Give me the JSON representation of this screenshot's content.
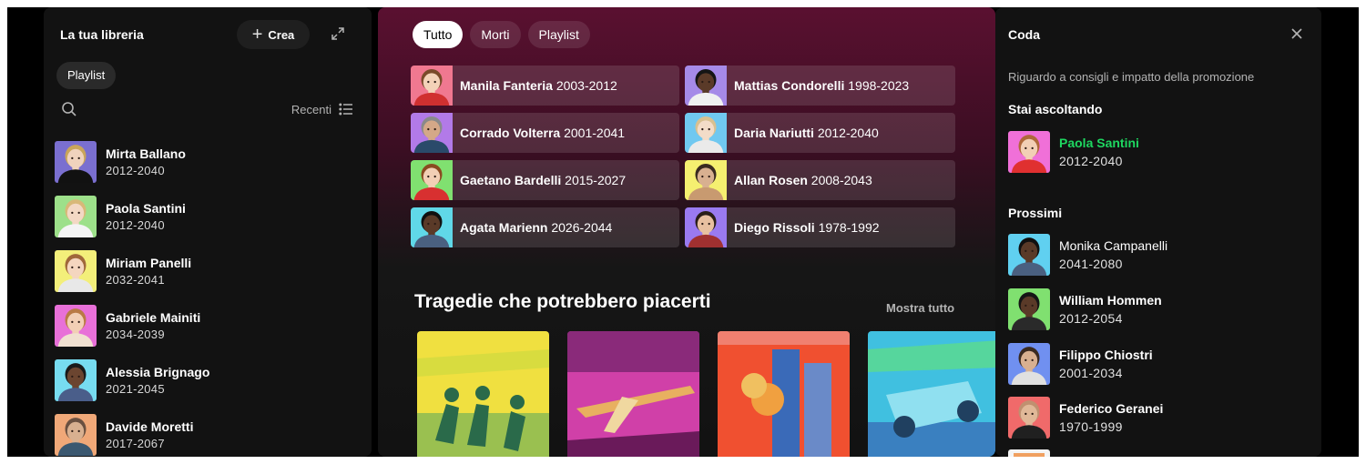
{
  "library": {
    "title": "La tua libreria",
    "create_label": "Crea",
    "filter_chip": "Playlist",
    "sort_label": "Recenti",
    "items": [
      {
        "name": "Mirta Ballano",
        "years": "2012-2040",
        "bg": "#7a6fd0",
        "skin": "#f0d2bd",
        "hair": "#c9a55a",
        "shirt": "#111111"
      },
      {
        "name": "Paola Santini",
        "years": "2012-2040",
        "bg": "#9de08a",
        "skin": "#f3d8c4",
        "hair": "#d8b878",
        "shirt": "#f4f4f4"
      },
      {
        "name": "Miriam Panelli",
        "years": "2032-2041",
        "bg": "#f3ef7a",
        "skin": "#f4d6bf",
        "hair": "#a0683a",
        "shirt": "#e8e8e8"
      },
      {
        "name": "Gabriele Mainiti",
        "years": "2034-2039",
        "bg": "#e870d8",
        "skin": "#f2cfb5",
        "hair": "#b97a45",
        "shirt": "#f0e0d0"
      },
      {
        "name": "Alessia Brignago",
        "years": "2021-2045",
        "bg": "#77dcf0",
        "skin": "#6b4530",
        "hair": "#1a1a1a",
        "shirt": "#4a5e8a"
      },
      {
        "name": "Davide Moretti",
        "years": "2017-2067",
        "bg": "#f0a878",
        "skin": "#d8b090",
        "hair": "#6a5040",
        "shirt": "#3b5870"
      }
    ]
  },
  "main": {
    "filters": [
      {
        "label": "Tutto",
        "active": true
      },
      {
        "label": "Morti",
        "active": false
      },
      {
        "label": "Playlist",
        "active": false
      }
    ],
    "tiles": [
      {
        "name": "Manila Fanteria",
        "years": "2003-2012",
        "bg": "#f07890",
        "skin": "#f3d2b8",
        "hair": "#7a4a2a",
        "shirt": "#d03030"
      },
      {
        "name": "Mattias Condorelli",
        "years": "1998-2023",
        "bg": "#a68ae8",
        "skin": "#5a3a28",
        "hair": "#151515",
        "shirt": "#f0f0f0"
      },
      {
        "name": "Corrado Volterra",
        "years": "2001-2041",
        "bg": "#b27ae8",
        "skin": "#d4a888",
        "hair": "#8a8a8a",
        "shirt": "#2a4a6a"
      },
      {
        "name": "Daria Nariutti",
        "years": "2012-2040",
        "bg": "#70c8f0",
        "skin": "#f3dcc8",
        "hair": "#d8c090",
        "shirt": "#eaeaea"
      },
      {
        "name": "Gaetano Bardelli",
        "years": "2015-2027",
        "bg": "#80e070",
        "skin": "#f2cfb5",
        "hair": "#8a4a20",
        "shirt": "#d83030"
      },
      {
        "name": "Allan Rosen",
        "years": "2008-2043",
        "bg": "#f5ef70",
        "skin": "#d8b090",
        "hair": "#3a2a20",
        "shirt": "#c89a70"
      },
      {
        "name": "Agata Marienn",
        "years": "2026-2044",
        "bg": "#60d8e8",
        "skin": "#5a3a28",
        "hair": "#101010",
        "shirt": "#4a6080"
      },
      {
        "name": "Diego Rissoli",
        "years": "1978-1992",
        "bg": "#9a7af0",
        "skin": "#e8c0a0",
        "hair": "#2a1e18",
        "shirt": "#a03030"
      }
    ],
    "section_title": "Tragedie che potrebbero piacerti",
    "show_all": "Mostra tutto",
    "cards": [
      {
        "subject": "soldiers",
        "c1": "#f0e040",
        "c2": "#2a6a4a"
      },
      {
        "subject": "plane-crash",
        "c1": "#d040a8",
        "c2": "#e8b060"
      },
      {
        "subject": "twin-towers",
        "c1": "#f05030",
        "c2": "#3a6ab8"
      },
      {
        "subject": "car-crash",
        "c1": "#40c0e0",
        "c2": "#60e080"
      }
    ]
  },
  "queue": {
    "title": "Coda",
    "info": "Riguardo a consigli e impatto della promozione",
    "now_playing_title": "Stai ascoltando",
    "now_playing": {
      "name": "Paola Santini",
      "years": "2012-2040",
      "bg": "#f070d8",
      "skin": "#f2cfb5",
      "hair": "#b0683a",
      "shirt": "#e03030"
    },
    "next_title": "Prossimi",
    "next": [
      {
        "name": "Monika Campanelli",
        "years": "2041-2080",
        "bg": "#60d0f0",
        "skin": "#5a3a28",
        "hair": "#101010",
        "shirt": "#4a6080",
        "bold": false
      },
      {
        "name": "William Hommen",
        "years": "2012-2054",
        "bg": "#80e070",
        "skin": "#5a3a28",
        "hair": "#151515",
        "shirt": "#2a2a2a",
        "bold": true
      },
      {
        "name": "Filippo Chiostri",
        "years": "2001-2034",
        "bg": "#7090f0",
        "skin": "#d8b090",
        "hair": "#3a2a20",
        "shirt": "#e0e0e0",
        "bold": true
      },
      {
        "name": "Federico Geranei",
        "years": "1970-1999",
        "bg": "#f06a6a",
        "skin": "#e0b898",
        "hair": "#c09070",
        "shirt": "#202020",
        "bold": true
      }
    ]
  }
}
